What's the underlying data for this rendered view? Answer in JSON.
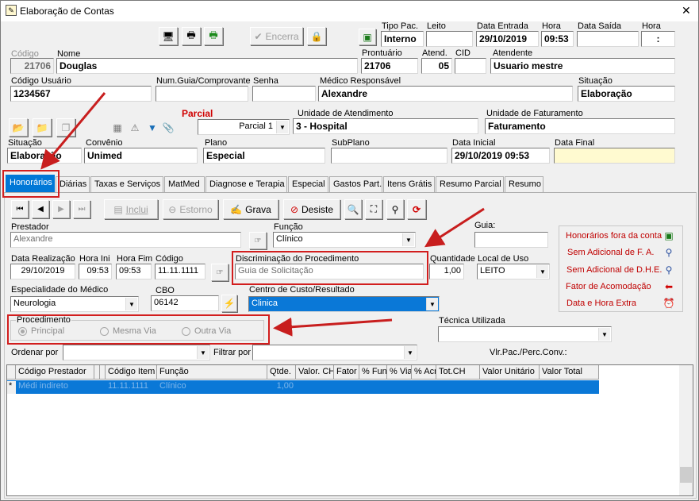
{
  "window": {
    "title": "Elaboração de Contas",
    "close": "✕"
  },
  "header": {
    "encerra_label": "Encerra",
    "codigo": {
      "label": "Código",
      "value": "21706"
    },
    "nome": {
      "label": "Nome",
      "value": "Douglas"
    },
    "tipo_pac": {
      "label": "Tipo Pac.",
      "value": "Interno"
    },
    "leito": {
      "label": "Leito",
      "value": ""
    },
    "data_entrada": {
      "label": "Data Entrada",
      "value": "29/10/2019"
    },
    "hora": {
      "label": "Hora",
      "value": "09:53"
    },
    "data_saida": {
      "label": "Data Saída",
      "value": ""
    },
    "hora_saida": {
      "label": "Hora",
      "value": ":"
    },
    "prontuario": {
      "label": "Prontuário",
      "value": "21706"
    },
    "atend": {
      "label": "Atend.",
      "value": "05"
    },
    "cid": {
      "label": "CID",
      "value": ""
    },
    "atendente": {
      "label": "Atendente",
      "value": "Usuario mestre"
    },
    "codigo_usuario": {
      "label": "Código Usuário",
      "value": "1234567"
    },
    "num_guia": {
      "label": "Num.Guia/Comprovante",
      "value": ""
    },
    "senha": {
      "label": "Senha",
      "value": ""
    },
    "medico": {
      "label": "Médico Responsável",
      "value": "Alexandre"
    },
    "situacao_top": {
      "label": "Situação",
      "value": "Elaboração"
    },
    "parcial_title": "Parcial",
    "parcial_combo": "Parcial 1",
    "unidade_atendimento": {
      "label": "Unidade de Atendimento",
      "value": "3 - Hospital"
    },
    "unidade_faturamento": {
      "label": "Unidade de Faturamento",
      "value": "Faturamento"
    },
    "situacao": {
      "label": "Situação",
      "value": "Elaboração"
    },
    "convenio": {
      "label": "Convênio",
      "value": "Unimed"
    },
    "plano": {
      "label": "Plano",
      "value": "Especial"
    },
    "subplano": {
      "label": "SubPlano",
      "value": ""
    },
    "data_inicial": {
      "label": "Data Inicial",
      "value": "29/10/2019 09:53"
    },
    "data_final": {
      "label": "Data Final",
      "value": ""
    }
  },
  "tabs": [
    "Honorários",
    "Diárias",
    "Taxas e Serviços",
    "MatMed",
    "Diagnose e Terapia",
    "Especial",
    "Gastos Part.",
    "Itens Grátis",
    "Resumo Parcial",
    "Resumo"
  ],
  "toolbar": {
    "inclui": "Inclui",
    "estorno": "Estorno",
    "grava": "Grava",
    "desiste": "Desiste"
  },
  "form": {
    "prestador": {
      "label": "Prestador",
      "value": "Alexandre"
    },
    "funcao": {
      "label": "Função",
      "value": "Clínico"
    },
    "guia": {
      "label": "Guia:",
      "value": ""
    },
    "data_realizacao": {
      "label": "Data Realização",
      "value": "29/10/2019"
    },
    "hora_ini": {
      "label": "Hora Ini",
      "value": "09:53"
    },
    "hora_fim": {
      "label": "Hora Fim",
      "value": "09:53"
    },
    "codigo": {
      "label": "Código",
      "value": "11.11.1111"
    },
    "discriminacao": {
      "label": "Discriminação do Procedimento",
      "value": "Guia de Solicitação"
    },
    "quantidade": {
      "label": "Quantidade",
      "value": "1,00"
    },
    "local_uso": {
      "label": "Local de Uso",
      "value": "LEITO"
    },
    "especialidade": {
      "label": "Especialidade do Médico",
      "value": "Neurologia"
    },
    "cbo": {
      "label": "CBO",
      "value": "06142"
    },
    "centro_custo": {
      "label": "Centro de Custo/Resultado",
      "value": "Clinica"
    },
    "procedimento": {
      "label": "Procedimento",
      "options": [
        "Principal",
        "Mesma Via",
        "Outra Via"
      ]
    },
    "tecnica": {
      "label": "Técnica Utilizada",
      "value": ""
    },
    "ordenar": {
      "label": "Ordenar por",
      "value": ""
    },
    "filtrar": {
      "label": "Filtrar por",
      "value": ""
    },
    "vlr_pac": "Vlr.Pac./Perc.Conv.:"
  },
  "side_links": [
    "Honorários fora da conta",
    "Sem Adicional de F. A.",
    "Sem Adicional de D.H.E.",
    "Fator de Acomodação",
    "Data e Hora Extra"
  ],
  "grid": {
    "columns": [
      "Código Prestador",
      "",
      "",
      "Código Item",
      "Função",
      "Qtde.",
      "Valor. CH",
      "Fator",
      "% Fun",
      "% Via",
      "% Acr",
      "Tot.CH",
      "Valor Unitário",
      "Valor Total"
    ],
    "row": {
      "marker": "*",
      "prestador": "Médi indireto",
      "item": "11.11.1111",
      "funcao": "Clínico",
      "qtde": "1,00"
    }
  }
}
